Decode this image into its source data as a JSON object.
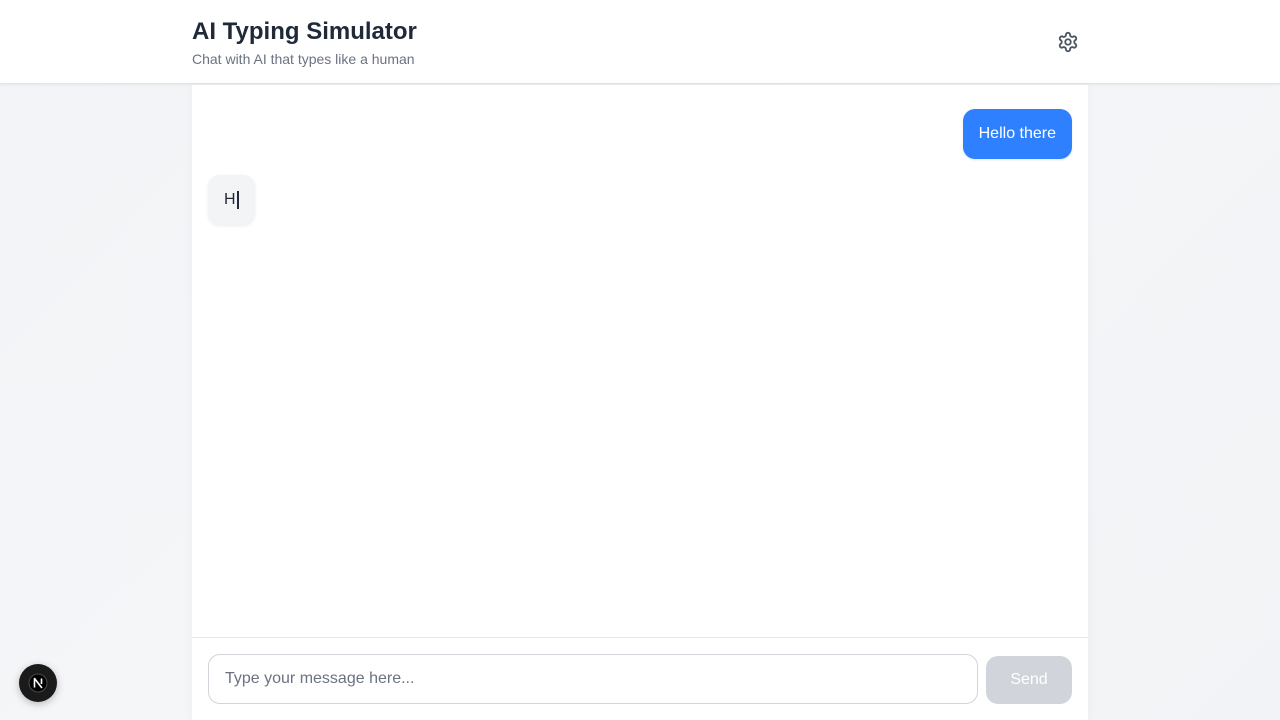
{
  "header": {
    "title": "AI Typing Simulator",
    "subtitle": "Chat with AI that types like a human",
    "settings_icon": "gear-icon"
  },
  "messages": [
    {
      "role": "user",
      "text": "Hello there"
    },
    {
      "role": "assistant",
      "text": "H",
      "typing": true
    }
  ],
  "composer": {
    "placeholder": "Type your message here...",
    "value": "",
    "send_label": "Send",
    "send_enabled": false
  },
  "dev_badge": {
    "icon": "nextjs-logo-icon"
  },
  "colors": {
    "user_bubble": "#2f80ff",
    "assistant_bubble": "#f3f4f6",
    "send_disabled": "#d1d5db"
  }
}
